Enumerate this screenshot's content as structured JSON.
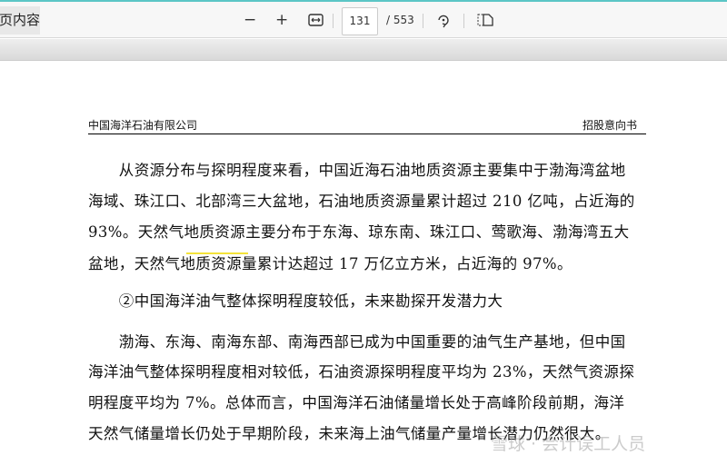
{
  "toolbar": {
    "left_label": "页内容",
    "zoom_out": "−",
    "zoom_in": "+",
    "fit_icon": "fit-width-icon",
    "page_current": "131",
    "page_total": "/ 553",
    "rotate_icon": "rotate-icon",
    "layout_icon": "page-layout-icon"
  },
  "document": {
    "header_left": "中国海洋石油有限公司",
    "header_right": "招股意向书",
    "lines": [
      "　　从资源分布与探明程度来看，中国近海石油地质资源主要集中于渤海湾盆地",
      "海域、珠江口、北部湾三大盆地，石油地质资源量累计超过 210 亿吨，占近海的",
      "93%。天然气地质资源主要分布于东海、琼东南、珠江口、莺歌海、渤海湾五大",
      "盆地，天然气地质资源量累计达超过 17 万亿立方米，占近海的 97%。",
      "　　②中国海洋油气整体探明程度较低，未来勘探开发潜力大",
      "　　渤海、东海、南海东部、南海西部已成为中国重要的油气生产基地，但中国",
      "海洋油气整体探明程度相对较低，石油资源探明程度平均为 23%，天然气资源探",
      "明程度平均为 7%。总体而言，中国海洋石油储量增长处于高峰阶段前期，海洋",
      "天然气储量增长仍处于早期阶段，未来海上油气储量产量增长潜力仍然很大。"
    ],
    "watermark": "雪球 · 会计误工人员"
  }
}
